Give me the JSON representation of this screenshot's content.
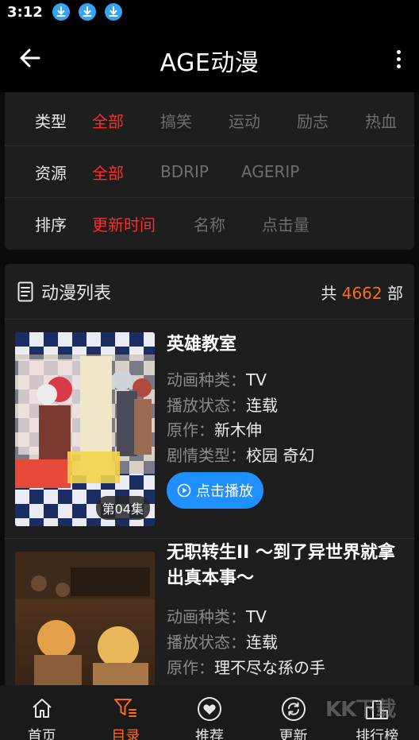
{
  "status_bar": {
    "time": "3:12"
  },
  "app_bar": {
    "title": "AGE动漫"
  },
  "filters": {
    "type": {
      "label": "类型",
      "options": [
        "全部",
        "搞笑",
        "运动",
        "励志",
        "热血"
      ]
    },
    "source": {
      "label": "资源",
      "options": [
        "全部",
        "BDRIP",
        "AGERIP"
      ]
    },
    "sort": {
      "label": "排序",
      "options": [
        "更新时间",
        "名称",
        "点击量"
      ]
    }
  },
  "list": {
    "title": "动漫列表",
    "count_prefix": "共",
    "count": "4662",
    "count_suffix": "部"
  },
  "items": [
    {
      "title": "英雄教室",
      "episode": "第04集",
      "fields": [
        {
          "label": "动画种类：",
          "value": "TV"
        },
        {
          "label": "播放状态：",
          "value": "连载"
        },
        {
          "label": "原作：",
          "value": "新木伸"
        },
        {
          "label": "剧情类型：",
          "value": "校园 奇幻"
        }
      ],
      "play_label": "点击播放"
    },
    {
      "title": "无职转生II ～到了异世界就拿出真本事～",
      "fields": [
        {
          "label": "动画种类：",
          "value": "TV"
        },
        {
          "label": "播放状态：",
          "value": "连载"
        },
        {
          "label": "原作：",
          "value": "理不尽な孫の手"
        }
      ]
    }
  ],
  "bottom_nav": [
    {
      "label": "首页",
      "icon": "home-icon"
    },
    {
      "label": "目录",
      "icon": "filter-list-icon",
      "active": true
    },
    {
      "label": "推荐",
      "icon": "heart-icon"
    },
    {
      "label": "更新",
      "icon": "refresh-icon"
    },
    {
      "label": "排行榜",
      "icon": "podium-icon"
    }
  ],
  "watermark": "KK下载",
  "colors": {
    "accent_red": "#ff2b2b",
    "accent_orange": "#ff6a1a",
    "play_blue": "#1e90ff"
  }
}
